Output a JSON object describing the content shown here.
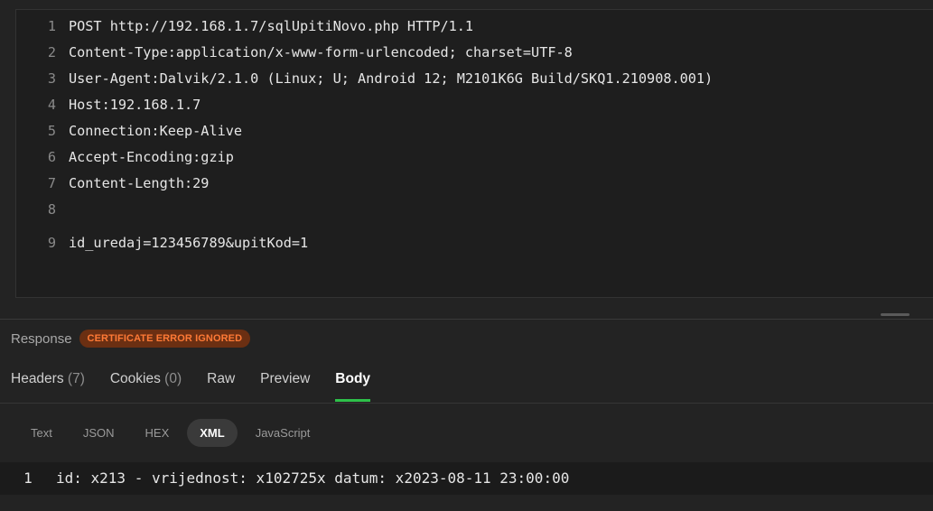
{
  "request": {
    "lines": [
      {
        "n": "1",
        "text": "POST http://192.168.1.7/sqlUpitiNovo.php HTTP/1.1"
      },
      {
        "n": "2",
        "text": "Content-Type:application/x-www-form-urlencoded; charset=UTF-8"
      },
      {
        "n": "3",
        "text": "User-Agent:Dalvik/2.1.0 (Linux; U; Android 12; M2101K6G Build/SKQ1.210908.001)"
      },
      {
        "n": "4",
        "text": "Host:192.168.1.7"
      },
      {
        "n": "5",
        "text": "Connection:Keep-Alive"
      },
      {
        "n": "6",
        "text": "Accept-Encoding:gzip"
      },
      {
        "n": "7",
        "text": "Content-Length:29"
      },
      {
        "n": "8",
        "text": ""
      },
      {
        "n": "9",
        "text": "id_uredaj=123456789&upitKod=1"
      }
    ]
  },
  "response": {
    "label": "Response",
    "badge": "CERTIFICATE ERROR IGNORED",
    "tabs": {
      "headers": {
        "label": "Headers",
        "count": "(7)"
      },
      "cookies": {
        "label": "Cookies",
        "count": "(0)"
      },
      "raw": {
        "label": "Raw"
      },
      "preview": {
        "label": "Preview"
      },
      "body": {
        "label": "Body"
      }
    },
    "formats": [
      "Text",
      "JSON",
      "HEX",
      "XML",
      "JavaScript"
    ],
    "selected_format": "XML",
    "body_lines": [
      {
        "n": "1",
        "text": "id: x213 - vrijednost: x102725x datum: x2023-08-11 23:00:00"
      }
    ]
  },
  "colors": {
    "accent_green": "#2ec04a",
    "badge_orange": "#ff7a36"
  }
}
